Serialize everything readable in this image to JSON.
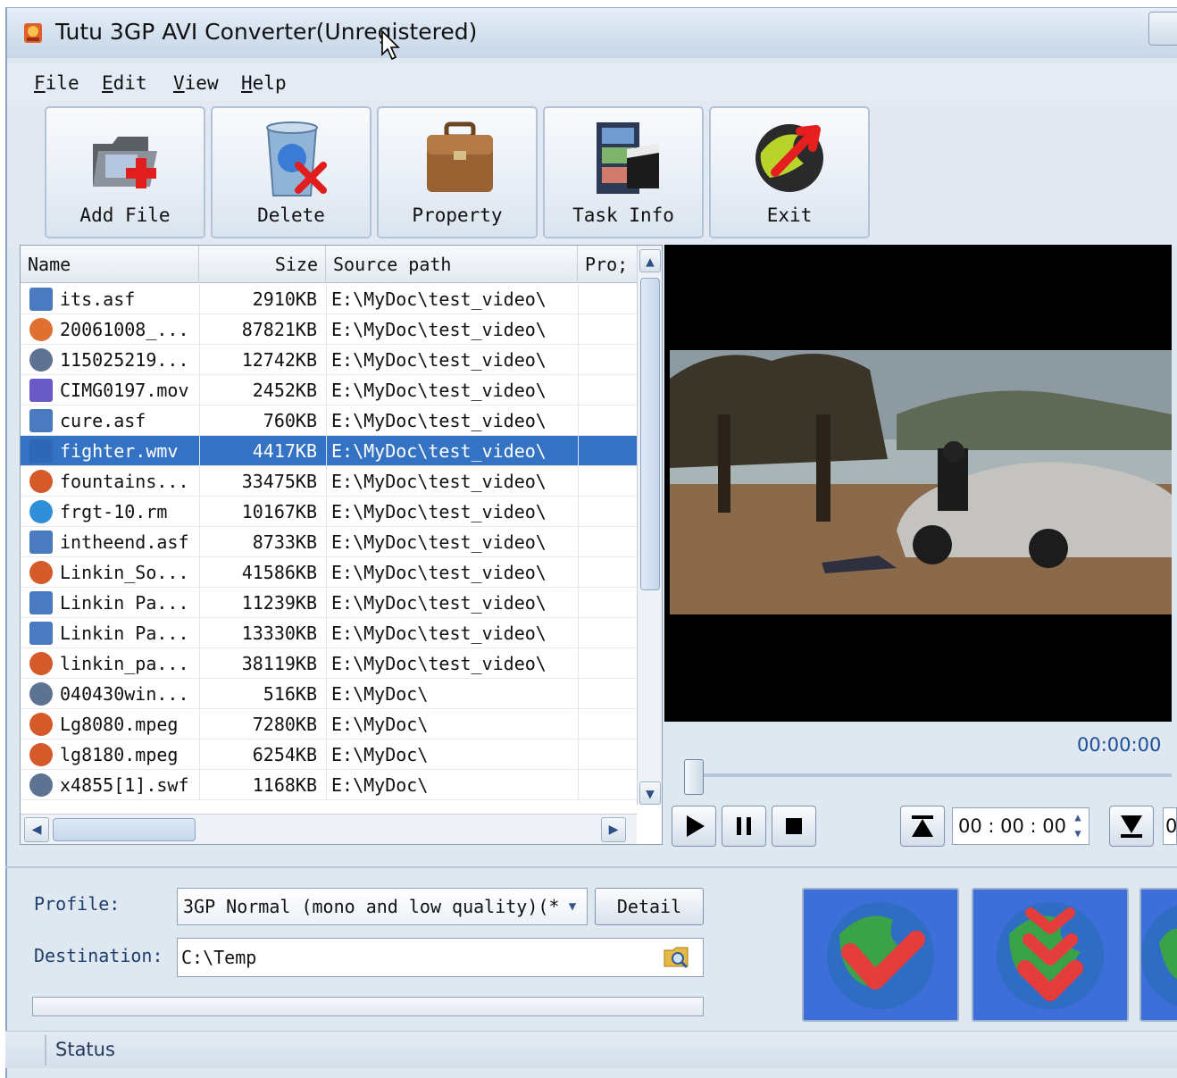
{
  "window": {
    "title": "Tutu 3GP AVI Converter(Unregistered)"
  },
  "menu": [
    {
      "label": "File",
      "accel": "F",
      "rest": "ile"
    },
    {
      "label": "Edit",
      "accel": "E",
      "rest": "dit"
    },
    {
      "label": "View",
      "accel": "V",
      "rest": "iew"
    },
    {
      "label": "Help",
      "accel": "H",
      "rest": "elp"
    }
  ],
  "toolbar": {
    "add_file": "Add File",
    "delete": "Delete",
    "property": "Property",
    "task_info": "Task Info",
    "exit": "Exit"
  },
  "table": {
    "headers": {
      "name": "Name",
      "size": "Size",
      "path": "Source path",
      "progress": "Pro;"
    },
    "rows": [
      {
        "name": "its.asf",
        "size": "2910KB",
        "path": "E:\\MyDoc\\test_video\\",
        "icon": "asf-icon"
      },
      {
        "name": "20061008_...",
        "size": "87821KB",
        "path": "E:\\MyDoc\\test_video\\",
        "icon": "3gp-icon"
      },
      {
        "name": "115025219...",
        "size": "12742KB",
        "path": "E:\\MyDoc\\test_video\\",
        "icon": "generic-icon"
      },
      {
        "name": "CIMG0197.mov",
        "size": "2452KB",
        "path": "E:\\MyDoc\\test_video\\",
        "icon": "mov-icon"
      },
      {
        "name": "cure.asf",
        "size": "760KB",
        "path": "E:\\MyDoc\\test_video\\",
        "icon": "asf-icon"
      },
      {
        "name": "fighter.wmv",
        "size": "4417KB",
        "path": "E:\\MyDoc\\test_video\\",
        "icon": "wmv-icon",
        "selected": true
      },
      {
        "name": "fountains...",
        "size": "33475KB",
        "path": "E:\\MyDoc\\test_video\\",
        "icon": "mpeg-icon"
      },
      {
        "name": "frgt-10.rm",
        "size": "10167KB",
        "path": "E:\\MyDoc\\test_video\\",
        "icon": "rm-icon"
      },
      {
        "name": "intheend.asf",
        "size": "8733KB",
        "path": "E:\\MyDoc\\test_video\\",
        "icon": "asf-icon"
      },
      {
        "name": "Linkin_So...",
        "size": "41586KB",
        "path": "E:\\MyDoc\\test_video\\",
        "icon": "mpeg-icon"
      },
      {
        "name": "Linkin Pa...",
        "size": "11239KB",
        "path": "E:\\MyDoc\\test_video\\",
        "icon": "asf-icon"
      },
      {
        "name": "Linkin Pa...",
        "size": "13330KB",
        "path": "E:\\MyDoc\\test_video\\",
        "icon": "asf-icon"
      },
      {
        "name": "linkin_pa...",
        "size": "38119KB",
        "path": "E:\\MyDoc\\test_video\\",
        "icon": "mpeg-icon"
      },
      {
        "name": "040430win...",
        "size": "516KB",
        "path": "E:\\MyDoc\\",
        "icon": "generic-icon"
      },
      {
        "name": "Lg8080.mpeg",
        "size": "7280KB",
        "path": "E:\\MyDoc\\",
        "icon": "mpeg-icon"
      },
      {
        "name": "lg8180.mpeg",
        "size": "6254KB",
        "path": "E:\\MyDoc\\",
        "icon": "mpeg-icon"
      },
      {
        "name": "x4855[1].swf",
        "size": "1168KB",
        "path": "E:\\MyDoc\\",
        "icon": "generic-icon"
      }
    ]
  },
  "player": {
    "time": "00:00:00",
    "clip_time": "00 : 00 : 00",
    "clip_time_trunc": "0"
  },
  "output": {
    "profile_label": "Profile:",
    "profile_value": "3GP Normal (mono and low quality)(*",
    "detail_label": "Detail",
    "destination_label": "Destination:",
    "destination_value": "C:\\Temp"
  },
  "status": {
    "text": "Status"
  },
  "colors": {
    "selection": "#3472c4",
    "accent_blue": "#3d6ed9",
    "window_bg": "#dfe7f1"
  }
}
